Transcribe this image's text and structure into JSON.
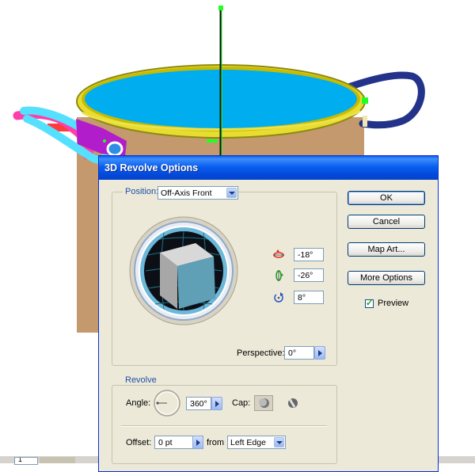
{
  "dialog": {
    "title": "3D Revolve Options",
    "position": {
      "label": "Position:",
      "preset": "Off-Axis Front",
      "x_rotation": "-18°",
      "y_rotation": "-26°",
      "z_rotation": "8°",
      "perspective_label": "Perspective:",
      "perspective_value": "0°"
    },
    "revolve": {
      "group_label": "Revolve",
      "angle_label": "Angle:",
      "angle_value": "360°",
      "cap_label": "Cap:",
      "offset_label": "Offset:",
      "offset_value": "0 pt",
      "from_label": "from",
      "from_value": "Left Edge"
    },
    "buttons": {
      "ok": "OK",
      "cancel": "Cancel",
      "map_art": "Map Art...",
      "more_options": "More Options"
    },
    "preview_label": "Preview",
    "preview_checked": true
  },
  "status_bar": {
    "page_value": "1"
  },
  "colors": {
    "pot_body": "#c4996d",
    "water": "#00aeef",
    "rim": "#d8c800",
    "handle": "#24338a",
    "accent_green": "#22ff22",
    "dialog_bg": "#ece9d8",
    "titlebar": "#0a5ef0"
  }
}
